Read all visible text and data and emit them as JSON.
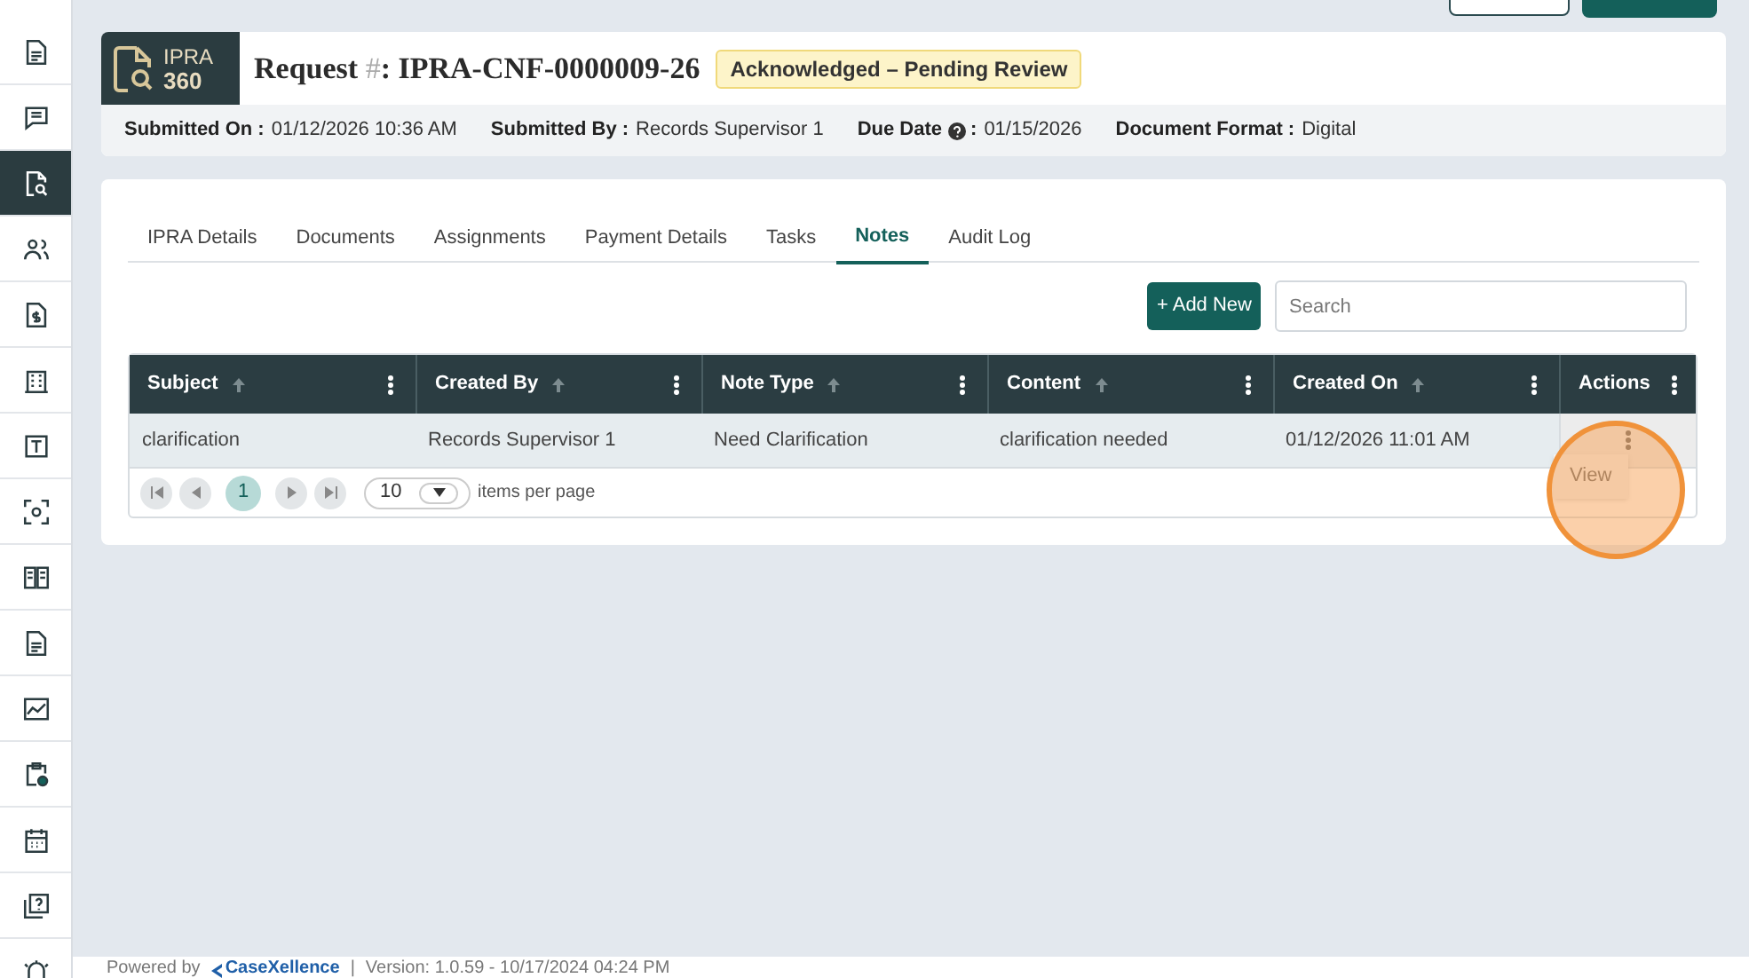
{
  "sidebar": {
    "items": [
      {
        "selected": false
      },
      {
        "selected": false
      },
      {
        "selected": true
      },
      {
        "selected": false
      },
      {
        "selected": false
      },
      {
        "selected": false
      },
      {
        "selected": false
      },
      {
        "selected": false
      },
      {
        "selected": false
      },
      {
        "selected": false
      },
      {
        "selected": false
      },
      {
        "selected": false
      },
      {
        "selected": false
      },
      {
        "selected": false
      },
      {
        "selected": false
      }
    ]
  },
  "logo": {
    "line_1": "IPRA",
    "line_2": "360"
  },
  "request": {
    "label": "Request",
    "hash": "#",
    "number": ": IPRA-CNF-0000009-26",
    "status": "Acknowledged – Pending Review"
  },
  "info": [
    {
      "label": "Submitted On :",
      "value": "01/12/2026 10:36 AM"
    },
    {
      "label": "Submitted By :",
      "value": "Records Supervisor 1"
    },
    {
      "label": "Due Date",
      "help": true,
      "sep": ":",
      "value": "01/15/2026"
    },
    {
      "label": "Document Format :",
      "value": "Digital"
    }
  ],
  "tabs": [
    {
      "label": "IPRA Details",
      "selected": false
    },
    {
      "label": "Documents",
      "selected": false
    },
    {
      "label": "Assignments",
      "selected": false
    },
    {
      "label": "Payment Details",
      "selected": false
    },
    {
      "label": "Tasks",
      "selected": false
    },
    {
      "label": "Notes",
      "selected": true
    },
    {
      "label": "Audit Log",
      "selected": false
    }
  ],
  "add_button": "+ Add New",
  "search": {
    "placeholder": "Search"
  },
  "table": {
    "columns": [
      {
        "label": "Subject",
        "sortable": true
      },
      {
        "label": "Created By",
        "sortable": true
      },
      {
        "label": "Note Type",
        "sortable": true
      },
      {
        "label": "Content",
        "sortable": true
      },
      {
        "label": "Created On",
        "sortable": true
      },
      {
        "label": "Actions",
        "sortable": false
      }
    ],
    "rows": [
      [
        "clarification",
        "Records Supervisor 1",
        "Need Clarification",
        "clarification needed",
        "01/12/2026 11:01 AM"
      ]
    ]
  },
  "pager": {
    "pages": [
      {
        "label": "1",
        "selected": true
      }
    ],
    "page_size": "10",
    "per_page_label": "items per page"
  },
  "action_menu": [
    "View"
  ],
  "footer": {
    "powered": "Powered by",
    "brand": "CaseXellence",
    "sep": "|",
    "version": "Version: 1.0.59 - 10/17/2024 04:24 PM"
  }
}
